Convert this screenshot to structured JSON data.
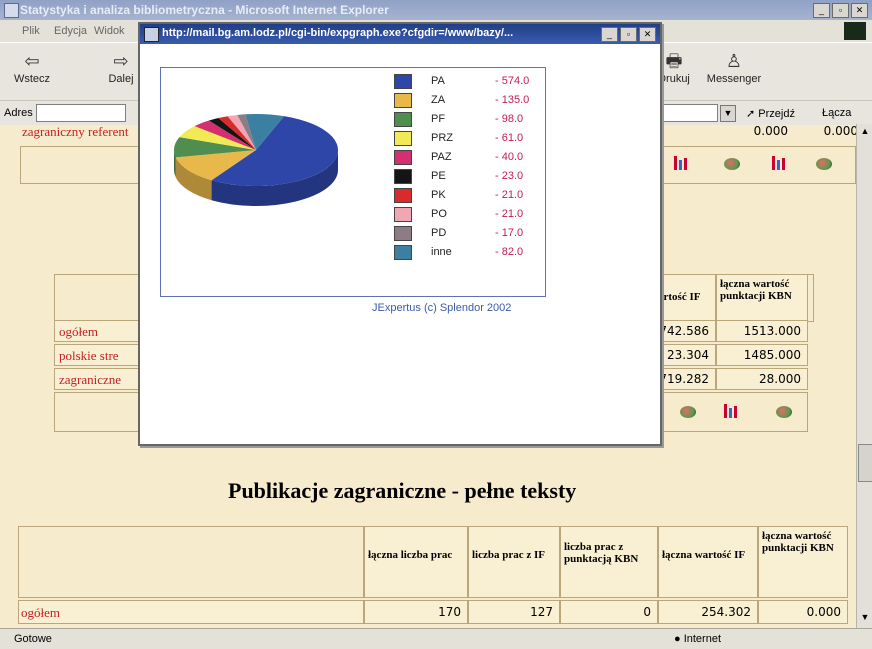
{
  "ie": {
    "title": "Statystyka i analiza bibliometryczna - Microsoft Internet Explorer",
    "menu": [
      "Plik",
      "Edycja",
      "Widok"
    ],
    "toolbar": {
      "back": "Wstecz",
      "forward": "Dalej",
      "print": "Drukuj",
      "messenger": "Messenger"
    },
    "address_label": "Adres",
    "go": "Przejdź",
    "links": "Łącza",
    "status": "Gotowe",
    "zone": "Internet"
  },
  "popup": {
    "title": "http://mail.bg.am.lodz.pl/cgi-bin/expgraph.exe?cfgdir=/www/bazy/...",
    "credit": "JExpertus  (c) Splendor 2002"
  },
  "chart_data": {
    "type": "pie",
    "categories": [
      "PA",
      "ZA",
      "PF",
      "PRZ",
      "PAZ",
      "PE",
      "PK",
      "PO",
      "PD",
      "inne"
    ],
    "values": [
      574.0,
      135.0,
      98.0,
      61.0,
      40.0,
      23.0,
      21.0,
      21.0,
      17.0,
      82.0
    ],
    "labels": [
      "- 574.0",
      "- 135.0",
      "- 98.0",
      "- 61.0",
      "- 40.0",
      "- 23.0",
      "- 21.0",
      "- 21.0",
      "- 17.0",
      "- 82.0"
    ],
    "colors": [
      "#2e46a8",
      "#e8b84a",
      "#4f8e4f",
      "#f2ea55",
      "#d42f6e",
      "#151515",
      "#d92b2b",
      "#f1a7b2",
      "#8b7c86",
      "#3b7fa3"
    ],
    "legend": "right"
  },
  "page": {
    "top_row_label": "zagraniczny referent",
    "top_values": [
      "0.000",
      "0.000"
    ],
    "rows": [
      "ogółem",
      "polskie stre",
      "zagraniczne"
    ],
    "col_if": "artość IF",
    "col_kbn": "łączna wartość punktacji KBN",
    "if_values": [
      "742.586",
      "23.304",
      "719.282"
    ],
    "kbn_values": [
      "1513.000",
      "1485.000",
      "28.000"
    ],
    "section_title": "Publikacje zagraniczne - pełne teksty",
    "bottom_headers": [
      "łączna liczba prac",
      "liczba prac z IF",
      "liczba prac z punktacją KBN",
      "łączna wartość IF",
      "łączna wartość punktacji KBN"
    ],
    "bottom_row_label": "ogółem",
    "bottom_values": [
      "170",
      "127",
      "0",
      "254.302",
      "0.000"
    ]
  }
}
